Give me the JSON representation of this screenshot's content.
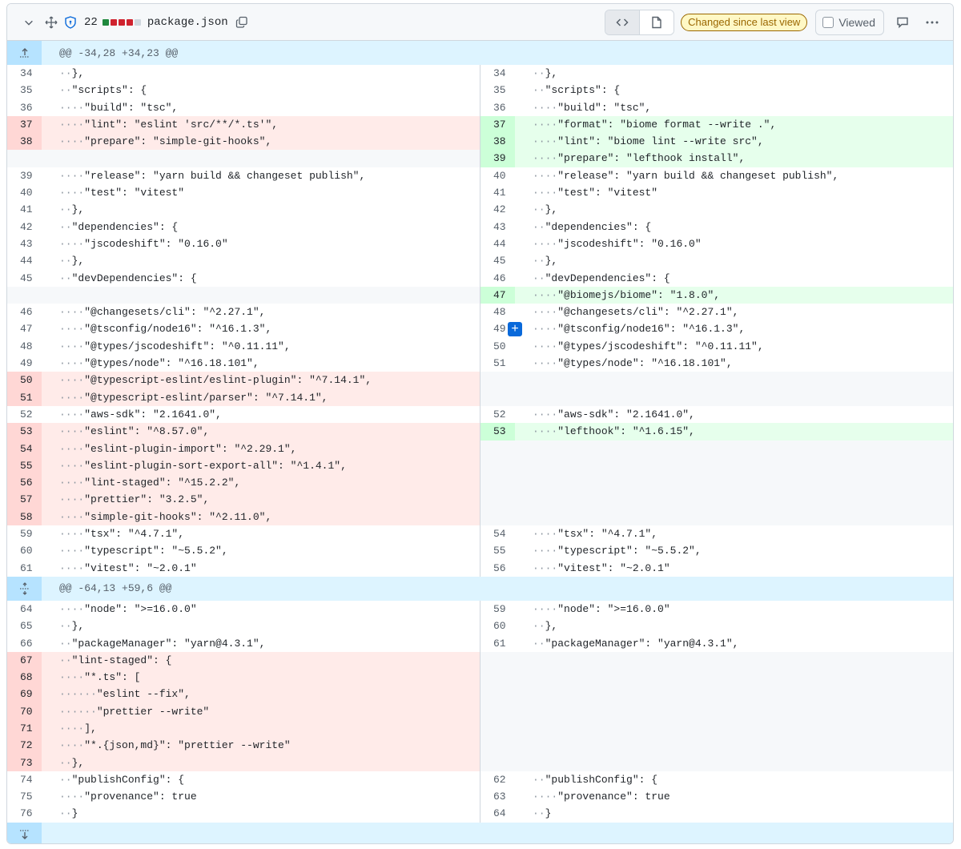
{
  "header": {
    "changes_count": "22",
    "filename": "package.json",
    "changed_badge": "Changed since last view",
    "viewed_label": "Viewed",
    "diffstat_colors": [
      "#1f883d",
      "#cf222e",
      "#cf222e",
      "#cf222e",
      "#d0d7de"
    ]
  },
  "hunks": [
    {
      "header": "@@ -34,28 +34,23 @@",
      "rows": [
        {
          "l": {
            "n": "34",
            "c": "  },",
            "t": "ctx"
          },
          "r": {
            "n": "34",
            "c": "  },",
            "t": "ctx"
          }
        },
        {
          "l": {
            "n": "35",
            "c": "  \"scripts\": {",
            "t": "ctx"
          },
          "r": {
            "n": "35",
            "c": "  \"scripts\": {",
            "t": "ctx"
          }
        },
        {
          "l": {
            "n": "36",
            "c": "    \"build\": \"tsc\",",
            "t": "ctx"
          },
          "r": {
            "n": "36",
            "c": "    \"build\": \"tsc\",",
            "t": "ctx"
          }
        },
        {
          "l": {
            "n": "37",
            "c": "    \"lint\": \"eslint 'src/**/*.ts'\",",
            "t": "del"
          },
          "r": {
            "n": "37",
            "c": "    \"format\": \"biome format --write .\",",
            "t": "add"
          }
        },
        {
          "l": {
            "n": "38",
            "c": "    \"prepare\": \"simple-git-hooks\",",
            "t": "del"
          },
          "r": {
            "n": "38",
            "c": "    \"lint\": \"biome lint --write src\",",
            "t": "add"
          }
        },
        {
          "l": {
            "n": "",
            "c": "",
            "t": "empty"
          },
          "r": {
            "n": "39",
            "c": "    \"prepare\": \"lefthook install\",",
            "t": "add"
          }
        },
        {
          "l": {
            "n": "39",
            "c": "    \"release\": \"yarn build && changeset publish\",",
            "t": "ctx"
          },
          "r": {
            "n": "40",
            "c": "    \"release\": \"yarn build && changeset publish\",",
            "t": "ctx"
          }
        },
        {
          "l": {
            "n": "40",
            "c": "    \"test\": \"vitest\"",
            "t": "ctx"
          },
          "r": {
            "n": "41",
            "c": "    \"test\": \"vitest\"",
            "t": "ctx"
          }
        },
        {
          "l": {
            "n": "41",
            "c": "  },",
            "t": "ctx"
          },
          "r": {
            "n": "42",
            "c": "  },",
            "t": "ctx"
          }
        },
        {
          "l": {
            "n": "42",
            "c": "  \"dependencies\": {",
            "t": "ctx"
          },
          "r": {
            "n": "43",
            "c": "  \"dependencies\": {",
            "t": "ctx"
          }
        },
        {
          "l": {
            "n": "43",
            "c": "    \"jscodeshift\": \"0.16.0\"",
            "t": "ctx"
          },
          "r": {
            "n": "44",
            "c": "    \"jscodeshift\": \"0.16.0\"",
            "t": "ctx"
          }
        },
        {
          "l": {
            "n": "44",
            "c": "  },",
            "t": "ctx"
          },
          "r": {
            "n": "45",
            "c": "  },",
            "t": "ctx"
          }
        },
        {
          "l": {
            "n": "45",
            "c": "  \"devDependencies\": {",
            "t": "ctx"
          },
          "r": {
            "n": "46",
            "c": "  \"devDependencies\": {",
            "t": "ctx"
          }
        },
        {
          "l": {
            "n": "",
            "c": "",
            "t": "empty"
          },
          "r": {
            "n": "47",
            "c": "    \"@biomejs/biome\": \"1.8.0\",",
            "t": "add"
          }
        },
        {
          "l": {
            "n": "46",
            "c": "    \"@changesets/cli\": \"^2.27.1\",",
            "t": "ctx"
          },
          "r": {
            "n": "48",
            "c": "    \"@changesets/cli\": \"^2.27.1\",",
            "t": "ctx"
          }
        },
        {
          "l": {
            "n": "47",
            "c": "    \"@tsconfig/node16\": \"^16.1.3\",",
            "t": "ctx"
          },
          "r": {
            "n": "49",
            "c": "    \"@tsconfig/node16\": \"^16.1.3\",",
            "t": "ctx",
            "plus": true
          }
        },
        {
          "l": {
            "n": "48",
            "c": "    \"@types/jscodeshift\": \"^0.11.11\",",
            "t": "ctx"
          },
          "r": {
            "n": "50",
            "c": "    \"@types/jscodeshift\": \"^0.11.11\",",
            "t": "ctx"
          }
        },
        {
          "l": {
            "n": "49",
            "c": "    \"@types/node\": \"^16.18.101\",",
            "t": "ctx"
          },
          "r": {
            "n": "51",
            "c": "    \"@types/node\": \"^16.18.101\",",
            "t": "ctx"
          }
        },
        {
          "l": {
            "n": "50",
            "c": "    \"@typescript-eslint/eslint-plugin\": \"^7.14.1\",",
            "t": "del"
          },
          "r": {
            "n": "",
            "c": "",
            "t": "empty"
          }
        },
        {
          "l": {
            "n": "51",
            "c": "    \"@typescript-eslint/parser\": \"^7.14.1\",",
            "t": "del"
          },
          "r": {
            "n": "",
            "c": "",
            "t": "empty"
          }
        },
        {
          "l": {
            "n": "52",
            "c": "    \"aws-sdk\": \"2.1641.0\",",
            "t": "ctx"
          },
          "r": {
            "n": "52",
            "c": "    \"aws-sdk\": \"2.1641.0\",",
            "t": "ctx"
          }
        },
        {
          "l": {
            "n": "53",
            "c": "    \"eslint\": \"^8.57.0\",",
            "t": "del"
          },
          "r": {
            "n": "53",
            "c": "    \"lefthook\": \"^1.6.15\",",
            "t": "add"
          }
        },
        {
          "l": {
            "n": "54",
            "c": "    \"eslint-plugin-import\": \"^2.29.1\",",
            "t": "del"
          },
          "r": {
            "n": "",
            "c": "",
            "t": "empty"
          }
        },
        {
          "l": {
            "n": "55",
            "c": "    \"eslint-plugin-sort-export-all\": \"^1.4.1\",",
            "t": "del"
          },
          "r": {
            "n": "",
            "c": "",
            "t": "empty"
          }
        },
        {
          "l": {
            "n": "56",
            "c": "    \"lint-staged\": \"^15.2.2\",",
            "t": "del"
          },
          "r": {
            "n": "",
            "c": "",
            "t": "empty"
          }
        },
        {
          "l": {
            "n": "57",
            "c": "    \"prettier\": \"3.2.5\",",
            "t": "del"
          },
          "r": {
            "n": "",
            "c": "",
            "t": "empty"
          }
        },
        {
          "l": {
            "n": "58",
            "c": "    \"simple-git-hooks\": \"^2.11.0\",",
            "t": "del"
          },
          "r": {
            "n": "",
            "c": "",
            "t": "empty"
          }
        },
        {
          "l": {
            "n": "59",
            "c": "    \"tsx\": \"^4.7.1\",",
            "t": "ctx"
          },
          "r": {
            "n": "54",
            "c": "    \"tsx\": \"^4.7.1\",",
            "t": "ctx"
          }
        },
        {
          "l": {
            "n": "60",
            "c": "    \"typescript\": \"~5.5.2\",",
            "t": "ctx"
          },
          "r": {
            "n": "55",
            "c": "    \"typescript\": \"~5.5.2\",",
            "t": "ctx"
          }
        },
        {
          "l": {
            "n": "61",
            "c": "    \"vitest\": \"~2.0.1\"",
            "t": "ctx"
          },
          "r": {
            "n": "56",
            "c": "    \"vitest\": \"~2.0.1\"",
            "t": "ctx"
          }
        }
      ]
    },
    {
      "header": "@@ -64,13 +59,6 @@",
      "rows": [
        {
          "l": {
            "n": "64",
            "c": "    \"node\": \">=16.0.0\"",
            "t": "ctx"
          },
          "r": {
            "n": "59",
            "c": "    \"node\": \">=16.0.0\"",
            "t": "ctx"
          }
        },
        {
          "l": {
            "n": "65",
            "c": "  },",
            "t": "ctx"
          },
          "r": {
            "n": "60",
            "c": "  },",
            "t": "ctx"
          }
        },
        {
          "l": {
            "n": "66",
            "c": "  \"packageManager\": \"yarn@4.3.1\",",
            "t": "ctx"
          },
          "r": {
            "n": "61",
            "c": "  \"packageManager\": \"yarn@4.3.1\",",
            "t": "ctx"
          }
        },
        {
          "l": {
            "n": "67",
            "c": "  \"lint-staged\": {",
            "t": "del"
          },
          "r": {
            "n": "",
            "c": "",
            "t": "empty"
          }
        },
        {
          "l": {
            "n": "68",
            "c": "    \"*.ts\": [",
            "t": "del"
          },
          "r": {
            "n": "",
            "c": "",
            "t": "empty"
          }
        },
        {
          "l": {
            "n": "69",
            "c": "      \"eslint --fix\",",
            "t": "del"
          },
          "r": {
            "n": "",
            "c": "",
            "t": "empty"
          }
        },
        {
          "l": {
            "n": "70",
            "c": "      \"prettier --write\"",
            "t": "del"
          },
          "r": {
            "n": "",
            "c": "",
            "t": "empty"
          }
        },
        {
          "l": {
            "n": "71",
            "c": "    ],",
            "t": "del"
          },
          "r": {
            "n": "",
            "c": "",
            "t": "empty"
          }
        },
        {
          "l": {
            "n": "72",
            "c": "    \"*.{json,md}\": \"prettier --write\"",
            "t": "del"
          },
          "r": {
            "n": "",
            "c": "",
            "t": "empty"
          }
        },
        {
          "l": {
            "n": "73",
            "c": "  },",
            "t": "del"
          },
          "r": {
            "n": "",
            "c": "",
            "t": "empty"
          }
        },
        {
          "l": {
            "n": "74",
            "c": "  \"publishConfig\": {",
            "t": "ctx"
          },
          "r": {
            "n": "62",
            "c": "  \"publishConfig\": {",
            "t": "ctx"
          }
        },
        {
          "l": {
            "n": "75",
            "c": "    \"provenance\": true",
            "t": "ctx"
          },
          "r": {
            "n": "63",
            "c": "    \"provenance\": true",
            "t": "ctx"
          }
        },
        {
          "l": {
            "n": "76",
            "c": "  }",
            "t": "ctx"
          },
          "r": {
            "n": "64",
            "c": "  }",
            "t": "ctx"
          }
        }
      ]
    }
  ]
}
